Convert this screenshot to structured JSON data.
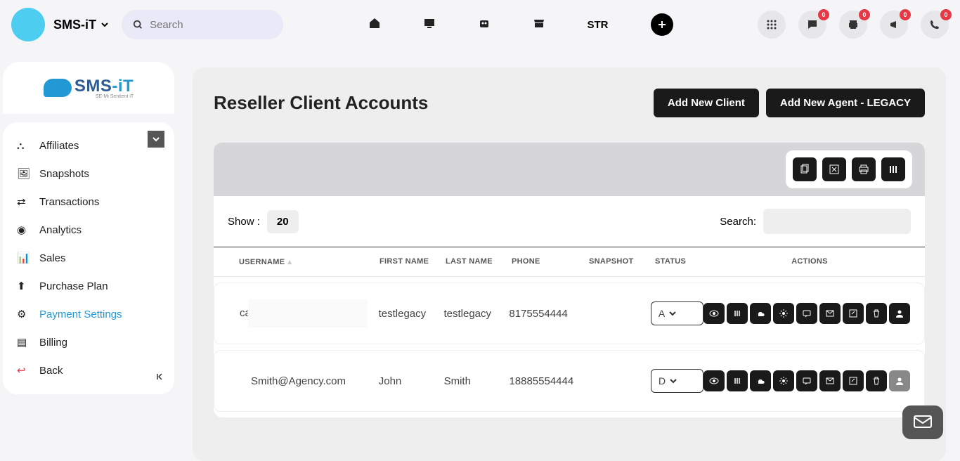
{
  "header": {
    "brand": "SMS-iT",
    "search_placeholder": "Search",
    "str_label": "STR",
    "badges": [
      "0",
      "0",
      "0",
      "0"
    ]
  },
  "sidebar": {
    "items": [
      {
        "label": "Affiliates"
      },
      {
        "label": "Snapshots"
      },
      {
        "label": "Transactions"
      },
      {
        "label": "Analytics"
      },
      {
        "label": "Sales"
      },
      {
        "label": "Purchase Plan"
      },
      {
        "label": "Payment Settings"
      },
      {
        "label": "Billing"
      },
      {
        "label": "Back"
      }
    ]
  },
  "page": {
    "title": "Reseller Client Accounts",
    "add_client": "Add New Client",
    "add_agent": "Add New Agent - LEGACY"
  },
  "table": {
    "show_label": "Show :",
    "show_value": "20",
    "search_label": "Search:",
    "columns": {
      "username": "USERNAME",
      "first_name": "FIRST NAME",
      "last_name": "LAST NAME",
      "phone": "PHONE",
      "snapshot": "SNAPSHOT",
      "status": "STATUS",
      "actions": "ACTIONS"
    },
    "rows": [
      {
        "username": "ca",
        "first_name": "testlegacy",
        "last_name": "testlegacy",
        "phone": "8175554444",
        "status": "A"
      },
      {
        "username": "Smith@Agency.com",
        "first_name": "John",
        "last_name": "Smith",
        "phone": "18885554444",
        "status": "D"
      }
    ]
  }
}
